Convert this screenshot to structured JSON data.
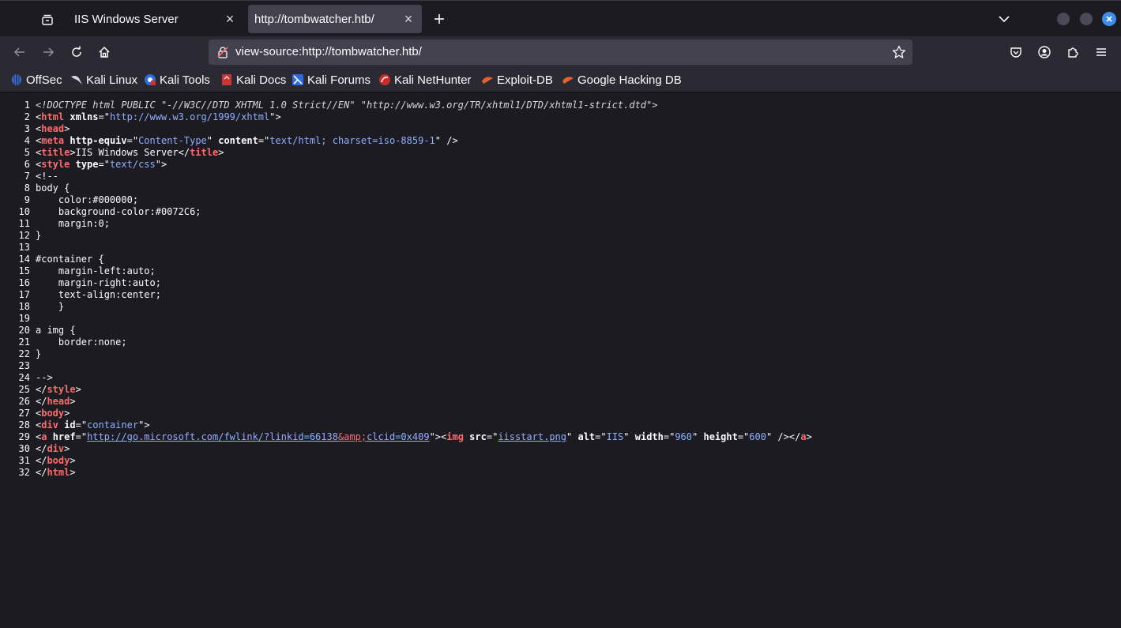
{
  "tabs": [
    {
      "label": "IIS Windows Server",
      "active": false
    },
    {
      "label": "http://tombwatcher.htb/",
      "active": true
    }
  ],
  "navbar": {
    "url": "view-source:http://tombwatcher.htb/"
  },
  "bookmarks": [
    {
      "label": "OffSec",
      "icon": "offsec-icon"
    },
    {
      "label": "Kali Linux",
      "icon": "kali-dragon-icon"
    },
    {
      "label": "Kali Tools",
      "icon": "kali-tools-icon"
    },
    {
      "label": "Kali Docs",
      "icon": "kali-docs-icon"
    },
    {
      "label": "Kali Forums",
      "icon": "kali-forums-icon"
    },
    {
      "label": "Kali NetHunter",
      "icon": "nethunter-icon"
    },
    {
      "label": "Exploit-DB",
      "icon": "exploit-db-icon"
    },
    {
      "label": "Google Hacking DB",
      "icon": "ghdb-icon"
    }
  ],
  "source": {
    "doctype": "<!DOCTYPE html PUBLIC \"-//W3C//DTD XHTML 1.0 Strict//EN\" \"http://www.w3.org/TR/xhtml1/DTD/xhtml1-strict.dtd\">",
    "html_xmlns": "http://www.w3.org/1999/xhtml",
    "meta_http_equiv": "Content-Type",
    "meta_content": "text/html; charset=iso-8859-1",
    "title": "IIS Windows Server",
    "style_type": "text/css",
    "css_lines": [
      "<!--",
      "body {",
      "    color:#000000;",
      "    background-color:#0072C6;",
      "    margin:0;",
      "}",
      "",
      "#container {",
      "    margin-left:auto;",
      "    margin-right:auto;",
      "    text-align:center;",
      "    }",
      "",
      "a img {",
      "    border:none;",
      "}",
      "",
      "-->"
    ],
    "div_id": "container",
    "a_href_part1": "http://go.microsoft.com/fwlink/?linkid=66138",
    "a_href_entity": "&amp;",
    "a_href_part2": "clcid=0x409",
    "img_src": "iisstart.png",
    "img_alt": "IIS",
    "img_width": "960",
    "img_height": "600"
  },
  "colors": {
    "tag": "#ff6b6b",
    "attr_value": "#8fb0ff",
    "background": "#1c1b22",
    "window_close": "#3d8eea"
  }
}
